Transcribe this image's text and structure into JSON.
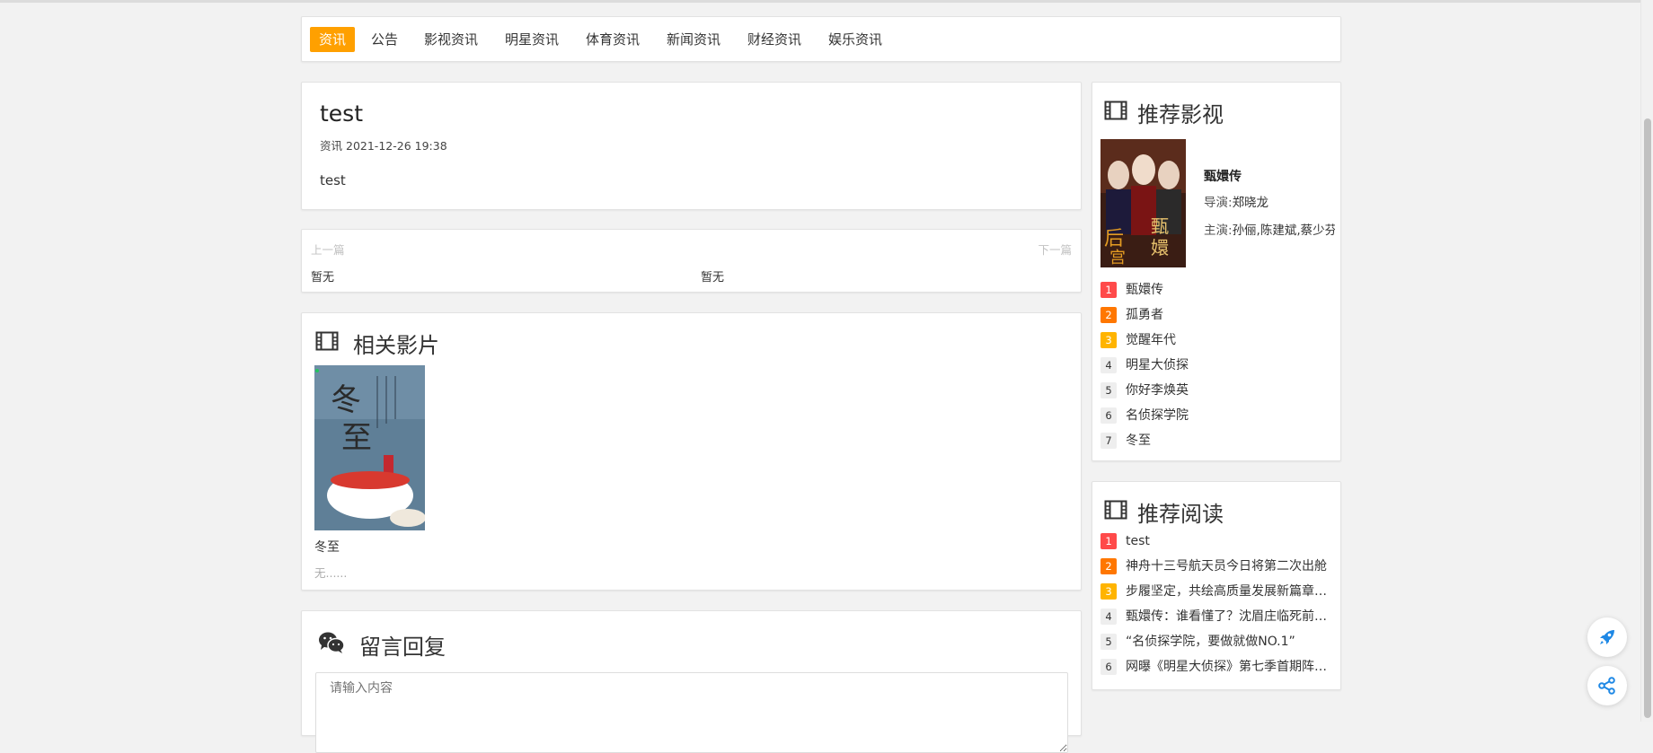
{
  "nav": {
    "items": [
      "资讯",
      "公告",
      "影视资讯",
      "明星资讯",
      "体育资讯",
      "新闻资讯",
      "财经资讯",
      "娱乐资讯"
    ],
    "active_index": 0
  },
  "article": {
    "title": "test",
    "category": "资讯",
    "date": "2021-12-26 19:38",
    "body": "test"
  },
  "prevnext": {
    "prev_label": "上一篇",
    "next_label": "下一篇",
    "prev_value": "暂无",
    "next_value": "暂无"
  },
  "related": {
    "title": "相关影片",
    "items": [
      {
        "title": "冬至",
        "desc": "无......"
      }
    ]
  },
  "comment": {
    "title": "留言回复",
    "placeholder": "请输入内容"
  },
  "rec_movies": {
    "title": "推荐影视",
    "featured": {
      "name": "甄嬛传",
      "director_label": "导演:",
      "director": "郑晓龙",
      "cast_label": "主演:",
      "cast": "孙俪,陈建斌,蔡少芬"
    },
    "ranking": [
      "甄嬛传",
      "孤勇者",
      "觉醒年代",
      "明星大侦探",
      "你好李焕英",
      "名侦探学院",
      "冬至"
    ]
  },
  "rec_reads": {
    "title": "推荐阅读",
    "ranking": [
      "test",
      "神舟十三号航天员今日将第二次出舱",
      "步履坚定，共绘高质量发展新篇章……",
      "甄嬛传：谁看懂了？沈眉庄临死前……",
      "“名侦探学院，要做就做NO.1”",
      "网曝《明星大侦探》第七季首期阵……"
    ]
  },
  "colors": {
    "accent": "#ffa000",
    "rank1": "#ff4a4a",
    "rank2": "#ff7701",
    "rank3": "#ffb400",
    "float_icon": "#1e88e5"
  },
  "icons": {
    "section_film": "film-icon",
    "comment": "wechat-icon",
    "float_top": "rocket-icon",
    "float_share": "share-icon"
  }
}
